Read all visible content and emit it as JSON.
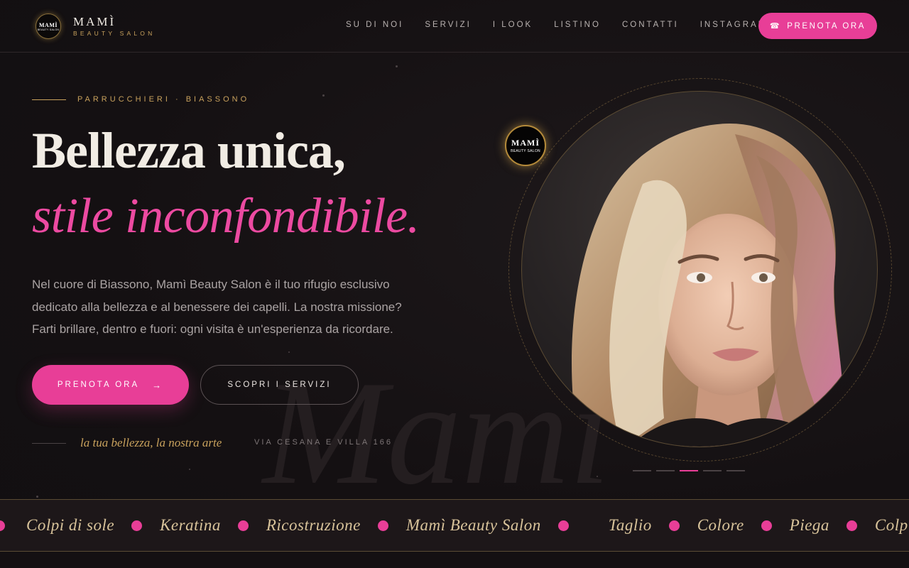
{
  "brand": {
    "title": "MAMÌ",
    "subtitle": "BEAUTY SALON",
    "badge_title": "MAMÌ",
    "badge_sub": "BEAUTY SALON"
  },
  "nav": {
    "items": [
      "SU DI NOI",
      "SERVIZI",
      "I LOOK",
      "LISTINO",
      "CONTATTI",
      "INSTAGRAM"
    ]
  },
  "header_cta": {
    "icon": "phone-icon",
    "label": "PRENOTA ORA"
  },
  "hero": {
    "eyebrow": "PARRUCCHIERI · BIASSONO",
    "title_line1": "Bellezza unica,",
    "title_line2": "stile inconfondibile.",
    "lead": "Nel cuore di Biassono, Mamì Beauty Salon è il tuo rifugio esclusivo dedicato alla bellezza e al benessere dei capelli. La nostra missione? Farti brillare, dentro e fuori: ogni visita è un'esperienza da ricordare.",
    "primary_button": "PRENOTA ORA",
    "primary_arrow": "→",
    "secondary_button": "SCOPRI I SERVIZI",
    "tagline": "la tua bellezza, la nostra arte",
    "address": "VIA CESANA E VILLA 166",
    "watermark": "Mamì"
  },
  "portrait_badge": {
    "title": "MAMÌ",
    "sub": "BEAUTY SALON"
  },
  "carousel": {
    "count": 5,
    "active_index": 2
  },
  "marquee": {
    "items": [
      "Colpi di sole",
      "Keratina",
      "Ricostruzione",
      "Mamì Beauty Salon",
      "Taglio",
      "Colore",
      "Piega",
      "Colpi di sole"
    ]
  },
  "colors": {
    "accent": "#e83e97",
    "gold": "#c9a25d",
    "background": "#151113",
    "text": "#f1ece4"
  }
}
